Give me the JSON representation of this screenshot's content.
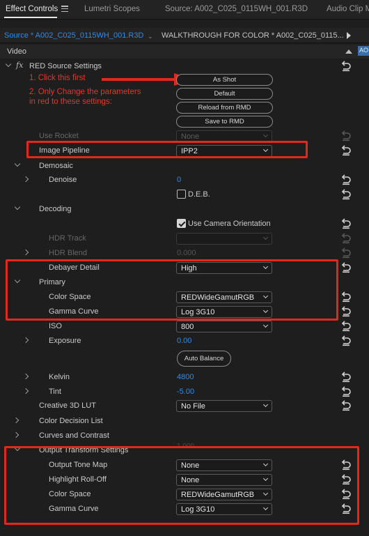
{
  "panel_tabs": [
    {
      "label": "Effect Controls",
      "active": true
    },
    {
      "label": "Lumetri Scopes"
    },
    {
      "label": "Source: A002_C025_0115WH_001.R3D"
    },
    {
      "label": "Audio Clip M"
    }
  ],
  "source_tabs": {
    "active": "Source * A002_C025_0115WH_001.R3D",
    "other": "WALKTHROUGH FOR COLOR * A002_C025_0115..."
  },
  "section": "Video",
  "corner_tag": "AO",
  "effect": {
    "fx": "fx",
    "name": "RED Source Settings"
  },
  "annotations": {
    "step1": "1. Click this first",
    "step2_line1": "2. Only Change the parameters",
    "step2_line2": "in red to these settings:"
  },
  "buttons": {
    "as_shot": "As Shot",
    "default": "Default",
    "reload": "Reload from RMD",
    "save": "Save to RMD",
    "auto_balance": "Auto Balance"
  },
  "rows": {
    "use_rocket": {
      "label": "Use Rocket",
      "value": "None"
    },
    "image_pipeline": {
      "label": "Image Pipeline",
      "value": "IPP2"
    },
    "demosaic": {
      "label": "Demosaic"
    },
    "denoise": {
      "label": "Denoise",
      "value": "0"
    },
    "deb": {
      "label": "D.E.B.",
      "checked": false
    },
    "decoding": {
      "label": "Decoding"
    },
    "camera_orientation": {
      "label": "Use Camera Orientation",
      "checked": true
    },
    "hdr_track": {
      "label": "HDR Track"
    },
    "hdr_blend": {
      "label": "HDR Blend",
      "value": "0.000"
    },
    "debayer_detail": {
      "label": "Debayer Detail",
      "value": "High"
    },
    "primary": {
      "label": "Primary"
    },
    "color_space": {
      "label": "Color Space",
      "value": "REDWideGamutRGB"
    },
    "gamma_curve": {
      "label": "Gamma Curve",
      "value": "Log 3G10"
    },
    "iso": {
      "label": "ISO",
      "value": "800"
    },
    "exposure": {
      "label": "Exposure",
      "value": "0.00"
    },
    "kelvin": {
      "label": "Kelvin",
      "value": "4800"
    },
    "tint": {
      "label": "Tint",
      "value": "-5.00"
    },
    "creative_lut": {
      "label": "Creative 3D LUT",
      "value": "No File"
    },
    "cdl": {
      "label": "Color Decision List"
    },
    "curves": {
      "label": "Curves and Contrast"
    },
    "output_transform": {
      "label": "Output Transform Settings",
      "faint_value": "1.000"
    },
    "output_tone_map": {
      "label": "Output Tone Map",
      "value": "None"
    },
    "highlight_rolloff": {
      "label": "Highlight Roll-Off",
      "value": "None"
    },
    "out_color_space": {
      "label": "Color Space",
      "value": "REDWideGamutRGB"
    },
    "out_gamma_curve": {
      "label": "Gamma Curve",
      "value": "Log 3G10"
    }
  },
  "colors": {
    "accent": "#2d8ceb",
    "annotation": "#e2291f",
    "background": "#1e1e1e"
  }
}
